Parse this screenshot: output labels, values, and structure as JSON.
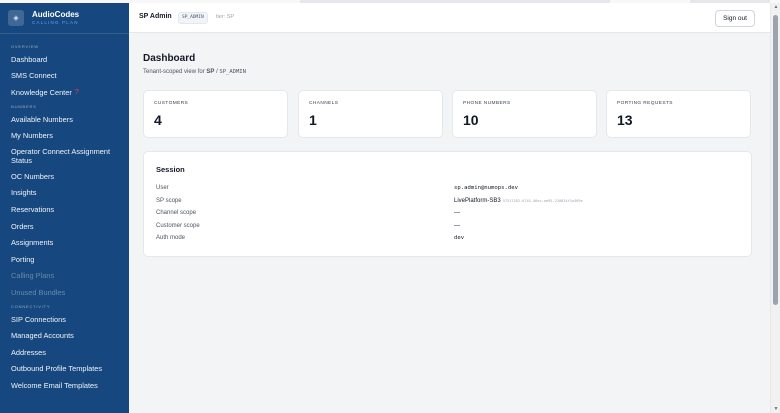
{
  "brand": {
    "title": "AudioCodes",
    "subtitle": "CALLING PLAN",
    "icon": "logo-icon"
  },
  "sidebar": {
    "sections": [
      {
        "label": "OVERVIEW"
      },
      {
        "label": "NUMBERS"
      },
      {
        "label": "CONNECTIVITY"
      }
    ],
    "items": [
      {
        "label": "Dashboard"
      },
      {
        "label": "SMS Connect"
      },
      {
        "label": "Knowledge Center",
        "badge": "?"
      },
      {
        "label": "Available Numbers"
      },
      {
        "label": "My Numbers"
      },
      {
        "label": "Operator Connect Assignment Status"
      },
      {
        "label": "OC Numbers"
      },
      {
        "label": "Insights"
      },
      {
        "label": "Reservations"
      },
      {
        "label": "Orders"
      },
      {
        "label": "Assignments"
      },
      {
        "label": "Porting"
      },
      {
        "label": "Calling Plans",
        "disabled": true
      },
      {
        "label": "Unused Bundles",
        "disabled": true
      },
      {
        "label": "SIP Connections"
      },
      {
        "label": "Managed Accounts"
      },
      {
        "label": "Addresses"
      },
      {
        "label": "Outbound Profile Templates"
      },
      {
        "label": "Welcome Email Templates"
      }
    ]
  },
  "header": {
    "role": "SP Admin",
    "role_code": "SP_ADMIN",
    "tier": "tier: SP",
    "sign_out": "Sign out"
  },
  "page": {
    "title": "Dashboard",
    "subtitle_prefix": "Tenant-scoped view for",
    "subtitle_sp": "SP",
    "subtitle_sep": "/",
    "subtitle_code": "SP_ADMIN"
  },
  "stats": [
    {
      "label": "CUSTOMERS",
      "value": "4"
    },
    {
      "label": "CHANNELS",
      "value": "1"
    },
    {
      "label": "PHONE NUMBERS",
      "value": "10"
    },
    {
      "label": "PORTING REQUESTS",
      "value": "13"
    }
  ],
  "session": {
    "title": "Session",
    "rows": [
      {
        "key": "User",
        "value": "sp.admin@numops.dev"
      },
      {
        "key": "SP scope",
        "value": "LivePlatform-SB3",
        "id": "57517182-6745-46ec-ae95-230824f1a369e"
      },
      {
        "key": "Channel scope",
        "value": "—"
      },
      {
        "key": "Customer scope",
        "value": "—"
      },
      {
        "key": "Auth mode",
        "value": "dev"
      }
    ]
  },
  "colors": {
    "sidebar": "#16477e",
    "accent": "#60a5fa",
    "badge": "#ef4444"
  }
}
